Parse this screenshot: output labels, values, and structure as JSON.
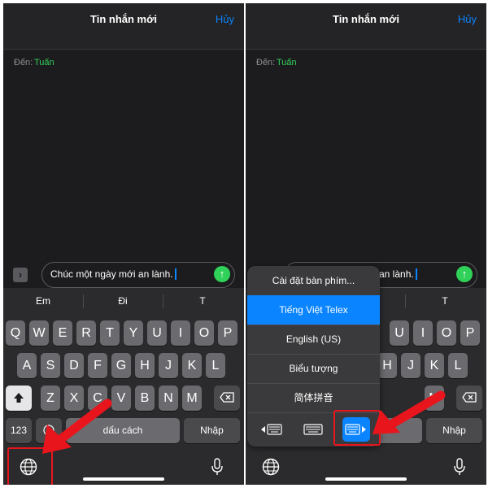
{
  "left": {
    "nav": {
      "title": "Tin nhắn mới",
      "cancel": "Hủy"
    },
    "to": {
      "label": "Đến:",
      "name": "Tuấn"
    },
    "message": {
      "text": "Chúc một ngày mới an lành."
    },
    "suggestions": [
      "Em",
      "Đi",
      "T"
    ],
    "keys": {
      "row1": [
        "Q",
        "W",
        "E",
        "R",
        "T",
        "Y",
        "U",
        "I",
        "O",
        "P"
      ],
      "row2": [
        "A",
        "S",
        "D",
        "F",
        "G",
        "H",
        "J",
        "K",
        "L"
      ],
      "row3": [
        "Z",
        "X",
        "C",
        "V",
        "B",
        "N",
        "M"
      ],
      "numbers": "123",
      "space": "dấu cách",
      "return": "Nhập"
    }
  },
  "right": {
    "nav": {
      "title": "Tin nhắn mới",
      "cancel": "Hủy"
    },
    "to": {
      "label": "Đến:",
      "name": "Tuấn"
    },
    "message": {
      "text": "an lành."
    },
    "suggestions": [
      "T"
    ],
    "keys": {
      "row1": [
        "U",
        "I",
        "O",
        "P"
      ],
      "row2": [
        "H",
        "J",
        "K",
        "L"
      ],
      "row3": [
        "M"
      ],
      "space_partial": "h",
      "return": "Nhập"
    },
    "menu": {
      "items": [
        "Cài đặt bàn phím...",
        "Tiếng Việt Telex",
        "English (US)",
        "Biểu tượng",
        "简体拼音"
      ],
      "selected_index": 1
    }
  },
  "colors": {
    "accent": "#0a84ff",
    "contact": "#30d158",
    "annotation": "#e8151d"
  }
}
